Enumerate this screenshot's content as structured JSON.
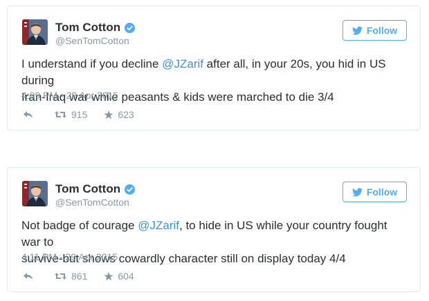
{
  "colors": {
    "accent": "#55acee",
    "mention": "#3b94d9",
    "muted": "#8899a6",
    "text": "#292f33",
    "border": "#e1e8ed"
  },
  "tweets": [
    {
      "name": "Tom Cotton",
      "handle": "@SenTomCotton",
      "follow_label": "Follow",
      "text_line1_pre": "I understand if you decline ",
      "mention": "@JZarif",
      "text_line1_post": " after all, in your 20s, you hid in US during",
      "text_line2": "Iran-Iraq war while peasants & kids were marched to die 3/4",
      "timestamp": "4:09 PM - 29 Apr 2015",
      "retweets": "915",
      "favorites": "623"
    },
    {
      "name": "Tom Cotton",
      "handle": "@SenTomCotton",
      "follow_label": "Follow",
      "text_line1_pre": "Not badge of courage ",
      "mention": "@JZarif",
      "text_line1_post": ", to hide in US while your country fought war to",
      "text_line2": "survive-but shows cowardly character still on display today 4/4",
      "timestamp": "4:11 PM - 29 Apr 2015",
      "retweets": "861",
      "favorites": "604"
    }
  ]
}
